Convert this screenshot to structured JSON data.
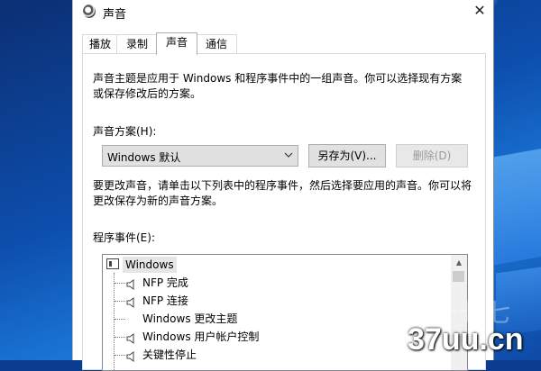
{
  "window": {
    "title": "声音",
    "close_glyph": "✕"
  },
  "tabs": [
    {
      "label": "播放",
      "active": false
    },
    {
      "label": "录制",
      "active": false
    },
    {
      "label": "声音",
      "active": true
    },
    {
      "label": "通信",
      "active": false
    }
  ],
  "sound_tab": {
    "description": "声音主题是应用于 Windows 和程序事件中的一组声音。你可以选择现有方案或保存修改后的方案。",
    "scheme_label": "声音方案(H):",
    "scheme_value": "Windows 默认",
    "save_as_label": "另存为(V)...",
    "delete_label": "删除(D)",
    "instructions": "要更改声音，请单击以下列表中的程序事件，然后选择要应用的声音。你可以将更改保存为新的声音方案。",
    "events_label": "程序事件(E):"
  },
  "events": {
    "group": "Windows",
    "items": [
      {
        "label": "NFP 完成",
        "has_sound": true
      },
      {
        "label": "NFP 连接",
        "has_sound": true
      },
      {
        "label": "Windows 更改主题",
        "has_sound": false
      },
      {
        "label": "Windows 用户帐户控制",
        "has_sound": true
      },
      {
        "label": "关键性停止",
        "has_sound": true
      }
    ]
  },
  "watermark": {
    "faint_text": "十七七",
    "text": "37uu.cn"
  },
  "colors": {
    "desktop_blue": "#0d4fae",
    "button_face": "#e1e1e1",
    "selected_group_bg": "#e5e5e5"
  }
}
